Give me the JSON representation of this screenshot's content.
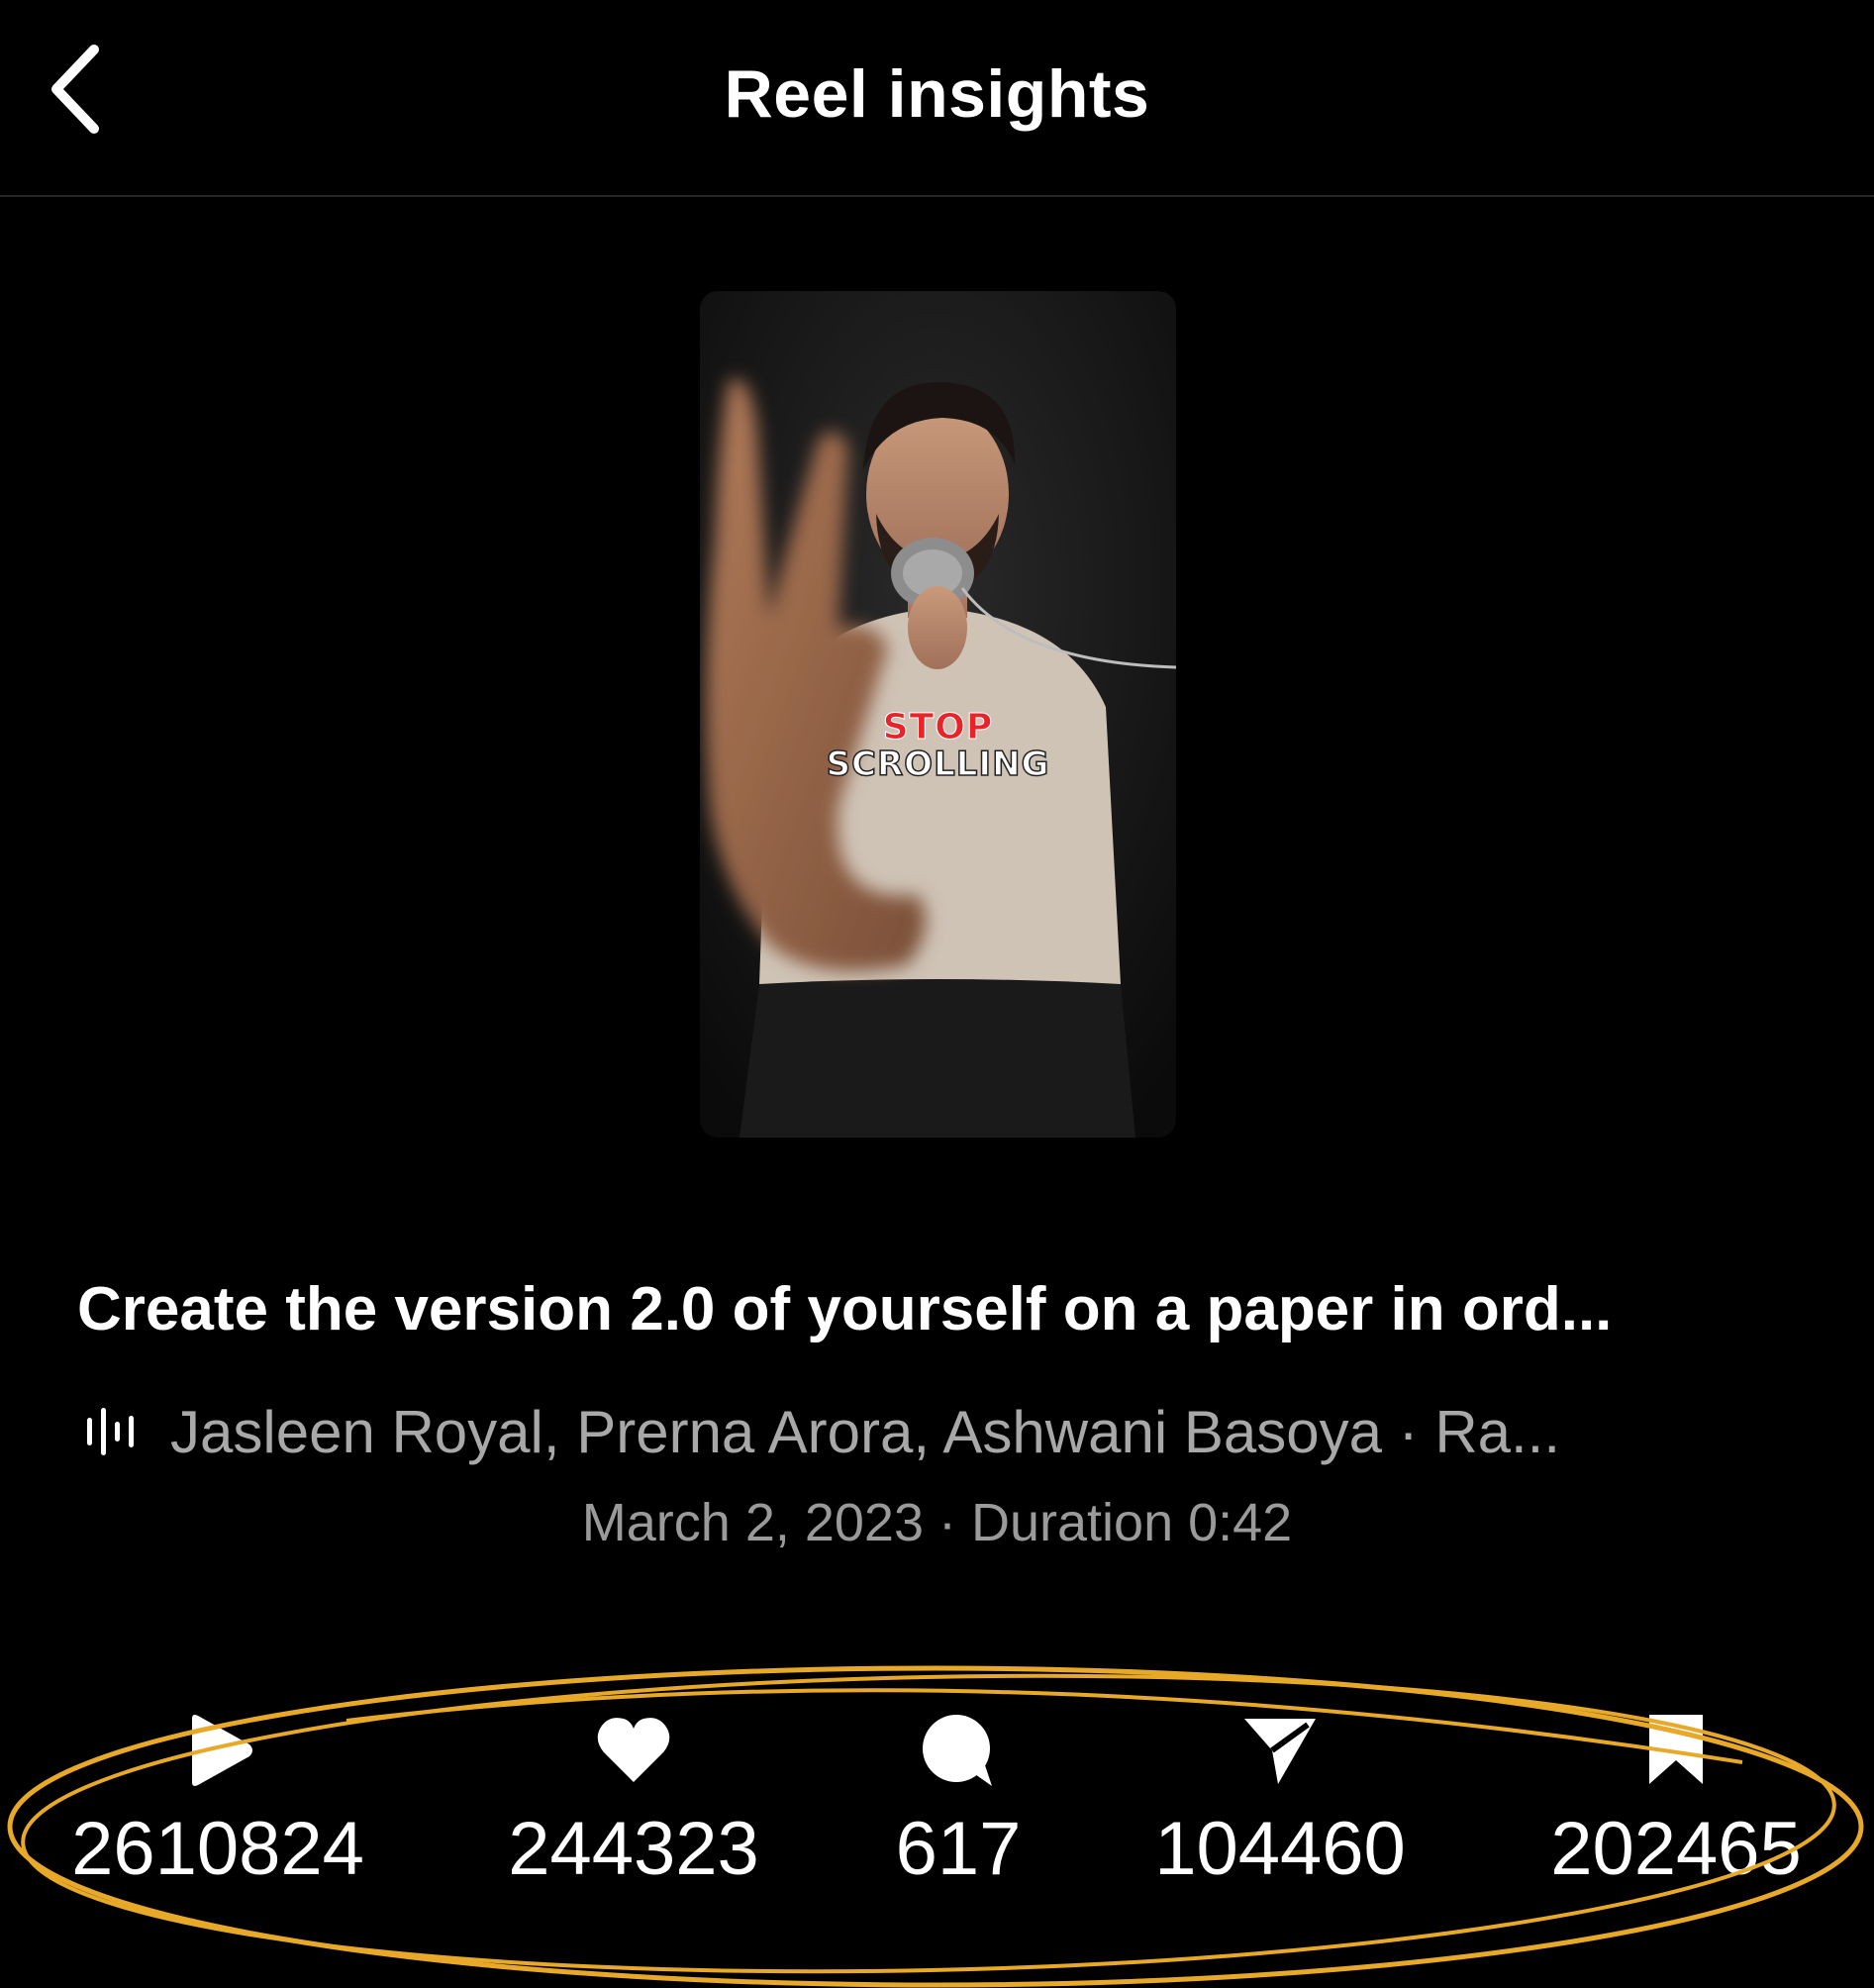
{
  "header": {
    "title": "Reel insights",
    "back_icon": "chevron-left-icon"
  },
  "thumbnail": {
    "overlay_line1": "STOP",
    "overlay_line2": "SCROLLING"
  },
  "reel": {
    "caption": "Create the version 2.0 of yourself on a paper in ord...",
    "audio_icon": "audio-waveform-icon",
    "audio": "Jasleen Royal, Prerna Arora, Ashwani Basoya · Ra...",
    "date": "March 2, 2023",
    "separator": "·",
    "duration": "Duration 0:42"
  },
  "stats": [
    {
      "icon": "play-icon",
      "value": "2610824"
    },
    {
      "icon": "heart-icon",
      "value": "244323"
    },
    {
      "icon": "comment-icon",
      "value": "617"
    },
    {
      "icon": "share-icon",
      "value": "104460"
    },
    {
      "icon": "bookmark-icon",
      "value": "202465"
    }
  ],
  "colors": {
    "background": "#000000",
    "text_primary": "#ffffff",
    "text_secondary": "#a8a8a8",
    "highlight_annotation": "#e8a928",
    "overlay_red": "#e8242a"
  }
}
